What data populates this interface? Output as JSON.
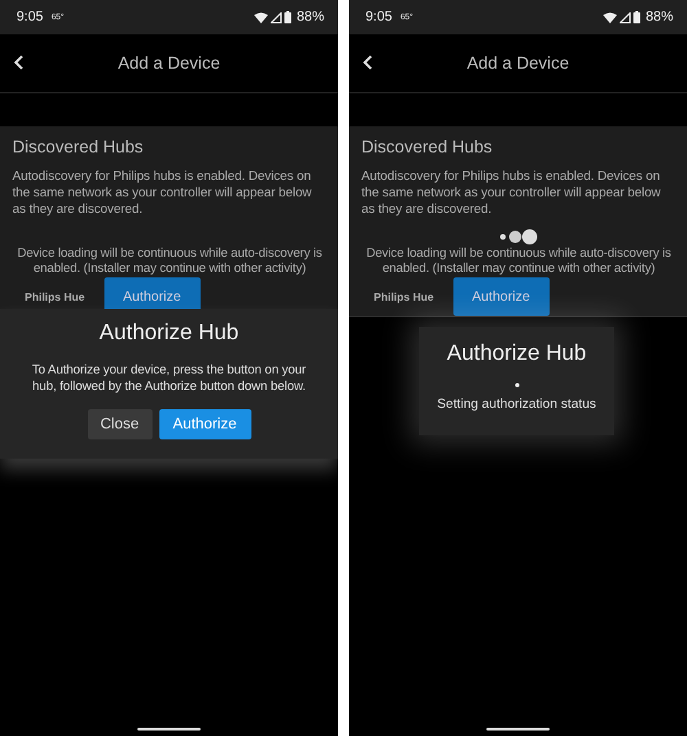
{
  "screens": [
    {
      "status_bar": {
        "time": "9:05",
        "temperature": "65°",
        "battery": "88%"
      },
      "header": {
        "title": "Add a Device"
      },
      "section": {
        "title": "Discovered Hubs",
        "description": "Autodiscovery for Philips hubs is enabled. Devices on the same network as your controller will appear below as they are discovered.",
        "loading": false,
        "loading_text": "Device loading will be continuous while auto-discovery is enabled. (Installer may continue with other activity)",
        "hubs": [
          {
            "name": "Philips Hue",
            "button": "Authorize"
          }
        ]
      },
      "dialog": {
        "kind": "confirm",
        "title": "Authorize Hub",
        "message": "To Authorize your device, press the button on your hub, followed by the Authorize button down below.",
        "buttons": [
          {
            "label": "Close",
            "primary": false
          },
          {
            "label": "Authorize",
            "primary": true
          }
        ]
      }
    },
    {
      "status_bar": {
        "time": "9:05",
        "temperature": "65°",
        "battery": "88%"
      },
      "header": {
        "title": "Add a Device"
      },
      "section": {
        "title": "Discovered Hubs",
        "description": "Autodiscovery for Philips hubs is enabled. Devices on the same network as your controller will appear below as they are discovered.",
        "loading": true,
        "loading_text": "Device loading will be continuous while auto-discovery is enabled. (Installer may continue with other activity)",
        "hubs": [
          {
            "name": "Philips Hue",
            "button": "Authorize"
          }
        ]
      },
      "dialog": {
        "kind": "progress",
        "title": "Authorize Hub",
        "status_text": "Setting authorization status"
      }
    }
  ]
}
